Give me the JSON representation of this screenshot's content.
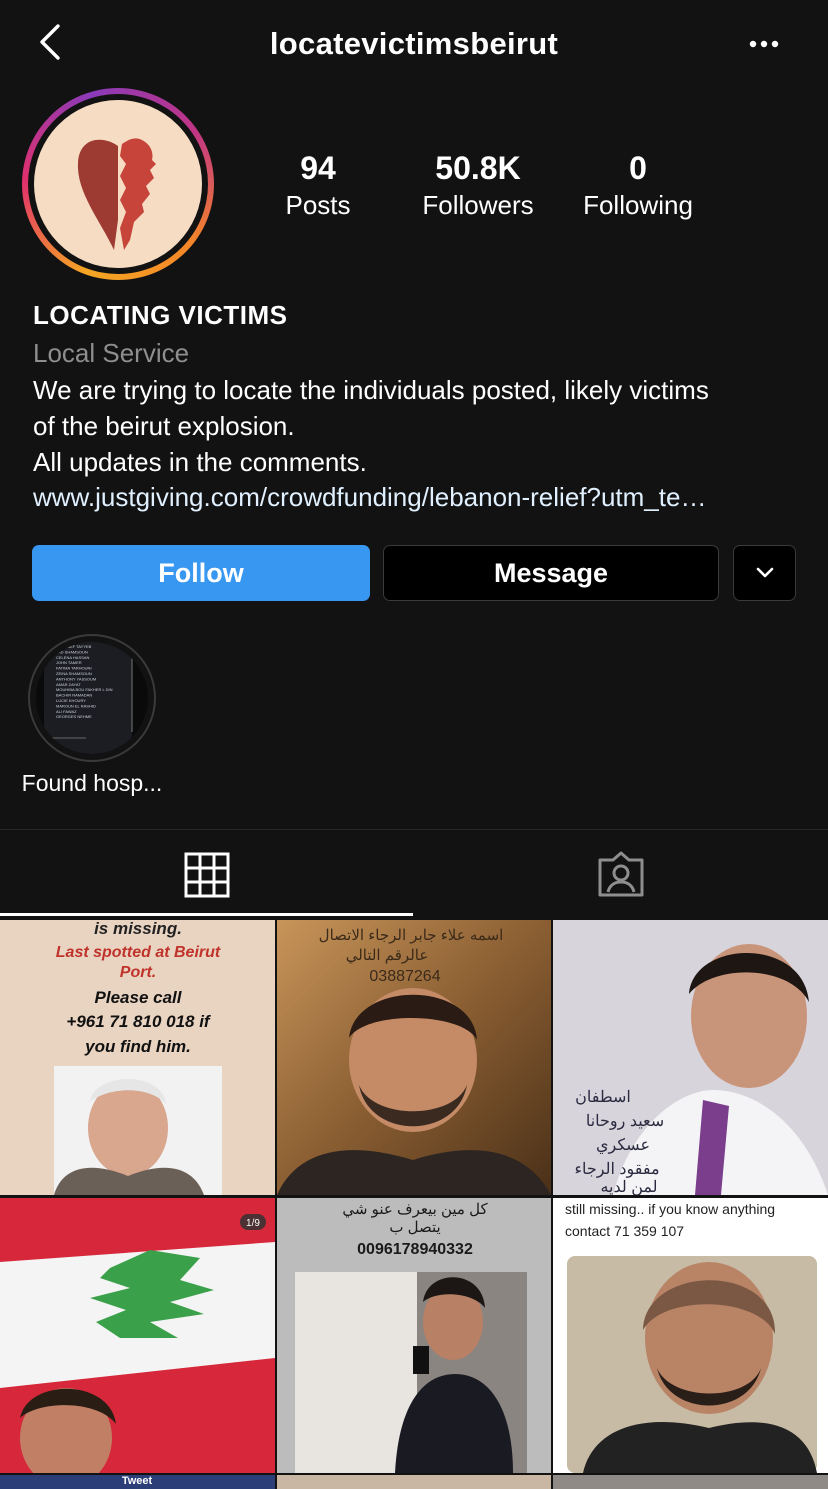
{
  "header": {
    "username": "locatevictimsbeirut"
  },
  "stats": [
    {
      "value": "94",
      "label": "Posts"
    },
    {
      "value": "50.8K",
      "label": "Followers"
    },
    {
      "value": "0",
      "label": "Following"
    }
  ],
  "profile": {
    "name": "LOCATING VICTIMS",
    "category": "Local Service",
    "bio_lines": [
      "We are trying to locate the individuals posted, likely victims",
      "of the beirut explosion.",
      "All updates in the comments."
    ],
    "link": "www.justgiving.com/crowdfunding/lebanon-relief?utm_te…"
  },
  "buttons": {
    "follow": "Follow",
    "message": "Message"
  },
  "highlight": {
    "label": "Found hosp...",
    "list": [
      "YOUSSEF TAYYEB",
      "JAD SHAMSOUN",
      "CELENA HASSAN",
      "JOHN TAMER",
      "FATIMA TARHOUNI",
      "ZEINA SHAMSOUN",
      "ANTHONY YASSOUM",
      "AMAR ZAYAT",
      "MOUHIBA BOU FAKHER L DIN",
      "BACHIR RAMADAN",
      "LUCIE KHOURY",
      "MAROUN EL RASHID",
      "ALI FAWAZ",
      "GEORGES NEHME"
    ]
  },
  "posts": {
    "p1": {
      "lines": [
        "is missing.",
        "Last spotted at Beirut",
        "Port.",
        "Please call",
        "+961 71 810 018 if",
        "you find him."
      ]
    },
    "p2": {
      "lines": [
        "اسمه علاء جابر الرجاء الاتصال",
        "عالرقم التالي",
        "03887264"
      ]
    },
    "p3": {
      "lines": [
        "اسطفان",
        "سعيد روحانا",
        "عسكري",
        "مفقود الرجاء",
        "لمن لديه"
      ]
    },
    "p4": {
      "badge": "1/9",
      "bottom_label": "Tweet"
    },
    "p5": {
      "lines": [
        "كل مين بيعرف عنو شي",
        "يتصل ب",
        "0096178940332"
      ]
    },
    "p6": {
      "lines": [
        "still missing.. if you know anything",
        "contact  71 359 107"
      ]
    }
  }
}
